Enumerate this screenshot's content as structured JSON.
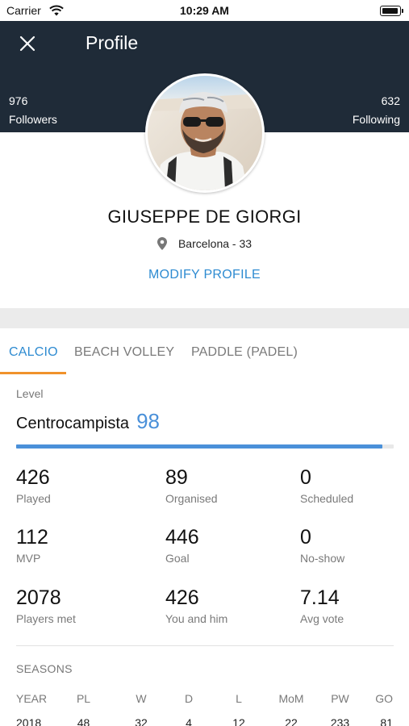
{
  "status_bar": {
    "carrier": "Carrier",
    "time": "10:29 AM"
  },
  "header": {
    "title": "Profile",
    "followers_count": "976",
    "followers_label": "Followers",
    "following_count": "632",
    "following_label": "Following",
    "icons": {
      "close": "close-icon"
    }
  },
  "profile": {
    "name": "GIUSEPPE DE GIORGI",
    "location": "Barcelona - 33",
    "modify_label": "MODIFY PROFILE"
  },
  "tabs": [
    {
      "label": "CALCIO",
      "active": true
    },
    {
      "label": "BEACH VOLLEY",
      "active": false
    },
    {
      "label": "PADDLE (PADEL)",
      "active": false
    }
  ],
  "level": {
    "label": "Level",
    "role": "Centrocampista",
    "value": "98",
    "progress_fraction": 0.97
  },
  "stats": [
    {
      "value": "426",
      "label": "Played"
    },
    {
      "value": "89",
      "label": "Organised"
    },
    {
      "value": "0",
      "label": "Scheduled"
    },
    {
      "value": "112",
      "label": "MVP"
    },
    {
      "value": "446",
      "label": "Goal"
    },
    {
      "value": "0",
      "label": "No-show"
    },
    {
      "value": "2078",
      "label": "Players met"
    },
    {
      "value": "426",
      "label": "You and him"
    },
    {
      "value": "7.14",
      "label": "Avg vote"
    }
  ],
  "seasons": {
    "label": "SEASONS",
    "columns": [
      "YEAR",
      "PL",
      "W",
      "D",
      "L",
      "MoM",
      "PW",
      "GO"
    ],
    "rows": [
      [
        "2018",
        "48",
        "32",
        "4",
        "12",
        "22",
        "233",
        "81"
      ]
    ]
  },
  "colors": {
    "header_bg": "#1f2b38",
    "accent_blue": "#2e8bd1",
    "level_blue": "#4a90d9",
    "tab_underline": "#f0922b"
  }
}
